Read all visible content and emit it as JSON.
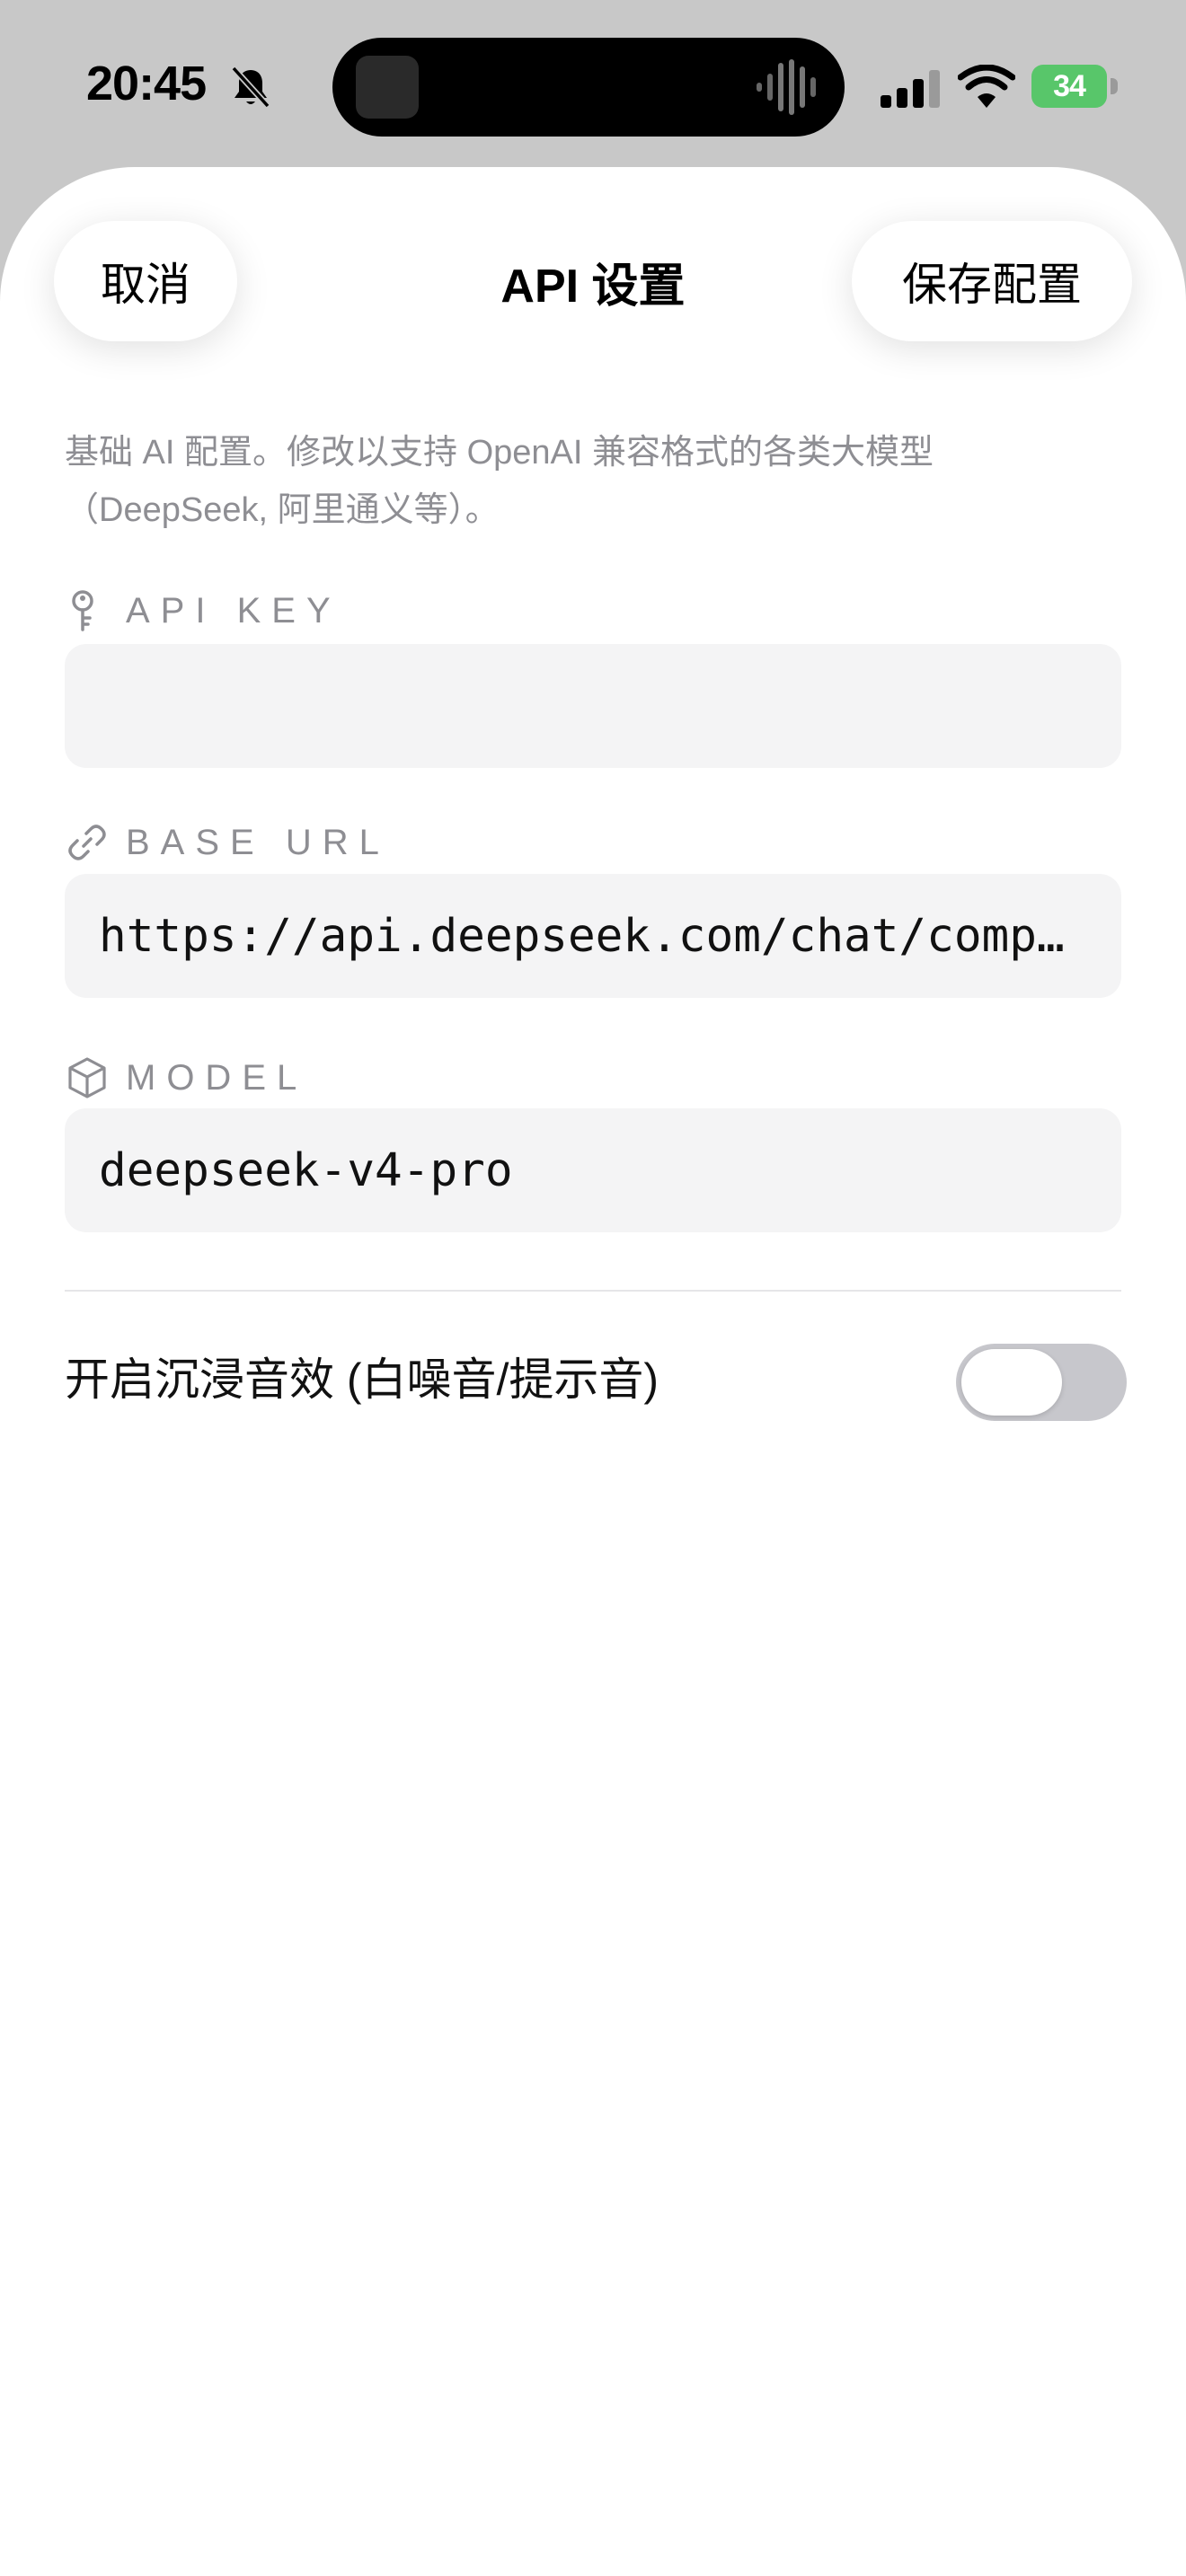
{
  "status_bar": {
    "time": "20:45",
    "battery_level": "34",
    "icons": [
      "bell-slash-icon",
      "signal-icon",
      "wifi-icon",
      "battery-charging-icon"
    ],
    "battery_color": "#58c66a"
  },
  "header": {
    "cancel_label": "取消",
    "title": "API 设置",
    "save_label": "保存配置"
  },
  "description": "基础 AI 配置。修改以支持 OpenAI 兼容格式的各类大模型（DeepSeek, 阿里通义等）。",
  "fields": [
    {
      "label": "API KEY",
      "icon": "key-icon",
      "value": "",
      "placeholder": ""
    },
    {
      "label": "BASE URL",
      "icon": "link-icon",
      "value": "https://api.deepseek.com/chat/completions"
    },
    {
      "label": "MODEL",
      "icon": "cube-icon",
      "value": "deepseek-v4-pro"
    }
  ],
  "settings": {
    "ambient_sound_label": "开启沉浸音效 (白噪音/提示音)",
    "ambient_sound_enabled": false
  },
  "colors": {
    "sheet_background": "#ffffff",
    "backdrop": "#c8c8c8",
    "input_background": "#f4f4f5",
    "secondary_text": "#8e8e93",
    "toggle_off": "#c7c7cc"
  }
}
